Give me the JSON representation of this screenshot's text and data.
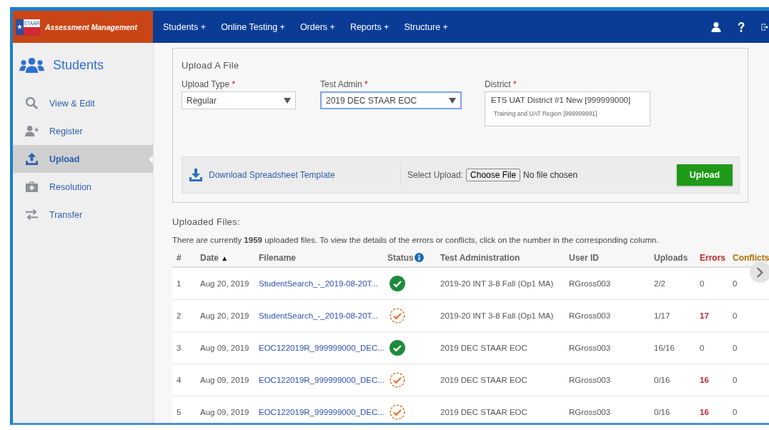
{
  "header": {
    "logo_text": "STAAR",
    "app_title": "Assessment Management",
    "nav": [
      {
        "label": "Students +"
      },
      {
        "label": "Online Testing +"
      },
      {
        "label": "Orders +"
      },
      {
        "label": "Reports +"
      },
      {
        "label": "Structure +"
      }
    ]
  },
  "sidebar": {
    "title": "Students",
    "items": [
      {
        "label": "View & Edit",
        "kind": "search",
        "selected": false
      },
      {
        "label": "Register",
        "kind": "register",
        "selected": false
      },
      {
        "label": "Upload",
        "kind": "upload",
        "selected": true
      },
      {
        "label": "Resolution",
        "kind": "resolution",
        "selected": false
      },
      {
        "label": "Transfer",
        "kind": "transfer",
        "selected": false
      }
    ]
  },
  "upload_form": {
    "title": "Upload A File",
    "upload_type": {
      "label": "Upload Type",
      "required_mark": "*",
      "value": "Regular",
      "focused": false
    },
    "test_admin": {
      "label": "Test Admin",
      "required_mark": "*",
      "value": "2019 DEC STAAR EOC",
      "focused": true
    },
    "district": {
      "label": "District",
      "required_mark": "*",
      "value": "ETS UAT District #1 New [999999000]",
      "region": "Training and UAT Region [999999991]"
    },
    "download_link": "Download Spreadsheet Template",
    "select_label": "Select Upload:",
    "choose_button": "Choose File",
    "file_status": "No file chosen",
    "upload_button": "Upload"
  },
  "uploaded": {
    "title": "Uploaded Files:",
    "description": "There are currently **1959** uploaded files. To view the details of the errors or conflicts, click on the number in the corresponding column.",
    "columns": [
      "#",
      "Date",
      "Filename",
      "Status",
      "Test Administration",
      "User ID",
      "Uploads",
      "Errors",
      "Conflicts"
    ],
    "sort_mark": "▲",
    "rows": [
      {
        "num": "1",
        "date": "Aug 20, 2019",
        "filename": "StudentSearch_-_2019-08-20T...",
        "kind": "complete",
        "test_admin": "2019-20 INT 3-8 Fall (Op1 MA)",
        "user": "RGross003",
        "uploads": "2/2",
        "errors": "0",
        "has_errors": false,
        "conflicts": "0"
      },
      {
        "num": "2",
        "date": "Aug 20, 2019",
        "filename": "StudentSearch_-_2019-08-20T...",
        "kind": "partial",
        "test_admin": "2019-20 INT 3-8 Fall (Op1 MA)",
        "user": "RGross003",
        "uploads": "1/17",
        "errors": "17",
        "has_errors": true,
        "conflicts": "0"
      },
      {
        "num": "3",
        "date": "Aug 09, 2019",
        "filename": "EOC122019R_999999000_DEC...",
        "kind": "complete",
        "test_admin": "2019 DEC STAAR EOC",
        "user": "RGross003",
        "uploads": "16/16",
        "errors": "0",
        "has_errors": false,
        "conflicts": "0"
      },
      {
        "num": "4",
        "date": "Aug 09, 2019",
        "filename": "EOC122019R_999999000_DEC...",
        "kind": "partial",
        "test_admin": "2019 DEC STAAR EOC",
        "user": "RGross003",
        "uploads": "0/16",
        "errors": "16",
        "has_errors": true,
        "conflicts": "0"
      },
      {
        "num": "5",
        "date": "Aug 09, 2019",
        "filename": "EOC122019R_999999000_DEC...",
        "kind": "partial",
        "test_admin": "2019 DEC STAAR EOC",
        "user": "RGross003",
        "uploads": "0/16",
        "errors": "16",
        "has_errors": true,
        "conflicts": "0"
      }
    ]
  }
}
